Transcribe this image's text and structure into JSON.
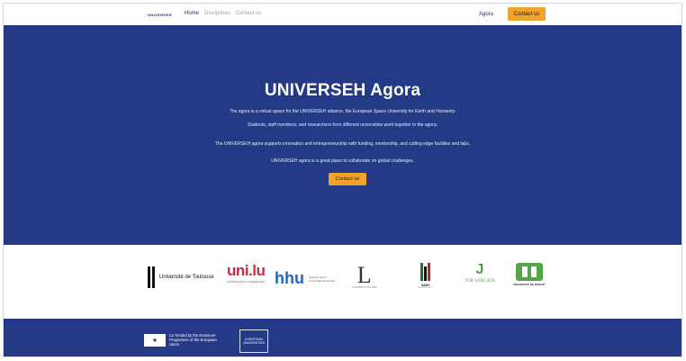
{
  "header": {
    "logo": "UNIVERSEH",
    "nav": [
      "Home",
      "Disciplines",
      "Contact us"
    ],
    "agora_link": "Agora",
    "contact_button": "Contact us"
  },
  "hero": {
    "title": "UNIVERSEH Agora",
    "p1": "The agora is a virtual space for the UNIVERSEH alliance, the European Space University for Earth and Humanity.",
    "p2": "Students, staff members, and researchers from different universities work together in the agora.",
    "p3": "The UNIVERSEH agora supports innovation and entrepreneurship with funding, mentorship, and cutting edge facilities and labs.",
    "p4": "UNIVERSEH agora is a great place to collaborate on global challenges.",
    "contact_button": "Contact us"
  },
  "partners": {
    "toulouse": "Université de Toulouse",
    "luxembourg": "uni.lu",
    "luxembourg_sub": "UNIVERSITÉ DU LUXEMBOURG",
    "hhu": "hhu",
    "hhu_sub": "Heinrich Heine Universität Düsseldorf",
    "lodz": "L",
    "lodz_sub": "UNIVERSITY OF ŁÓDŹ",
    "agh": "AGH",
    "agh_sub": "AGH UNIVERSITY",
    "vergata": "TOR VERGATA",
    "namur": "UNIVERSITÉ DE NAMUR"
  },
  "footer": {
    "eu_text": "Co-funded by the Erasmus+ Programme of the European Union",
    "eu_univ": "EUROPEAN UNIVERSITIES"
  },
  "colors": {
    "navy": "#253a86",
    "accent": "#f0a32a"
  },
  "icons": {
    "eu_flag": "eu-flag-icon"
  }
}
